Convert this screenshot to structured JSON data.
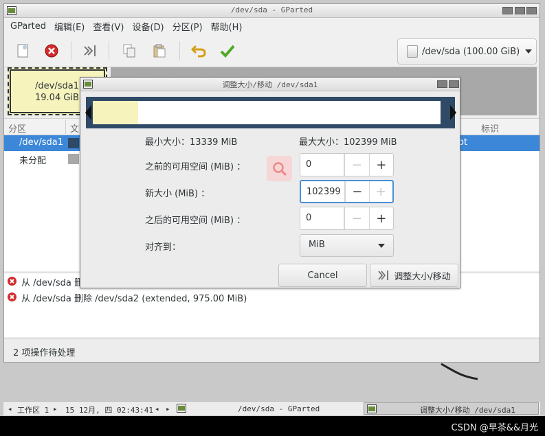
{
  "main_window": {
    "title": "/dev/sda - GParted",
    "menu": [
      "GParted",
      "编辑(E)",
      "查看(V)",
      "设备(D)",
      "分区(P)",
      "帮助(H)"
    ],
    "device_selector": "/dev/sda (100.00 GiB)"
  },
  "diskmap": {
    "partition_name": "/dev/sda1",
    "partition_size": "19.04 GiB"
  },
  "partition_list": {
    "headers": {
      "partition": "分区",
      "fs": "文",
      "flags": "标识"
    },
    "rows": [
      {
        "name": "/dev/sda1",
        "flag_partial": "ot",
        "selected": true,
        "fs_color": "#2f4a66"
      },
      {
        "name": "未分配",
        "flag_partial": "",
        "selected": false,
        "fs_color": "#a8a8a8"
      }
    ]
  },
  "operations": [
    "从 /dev/sda 删",
    "从 /dev/sda 删除 /dev/sda2 (extended, 975.00 MiB)"
  ],
  "status": "2 项操作待处理",
  "dialog": {
    "title": "调整大小/移动 /dev/sda1",
    "min_size": "最小大小：13339  MiB",
    "max_size": "最大大小：102399  MiB",
    "free_before_label": "之前的可用空间 (MiB) ：",
    "free_before_value": "0",
    "new_size_label": "新大小 (MiB) ：",
    "new_size_value": "102399",
    "free_after_label": "之后的可用空间 (MiB) ：",
    "free_after_value": "0",
    "align_label": "对齐到：",
    "align_value": "MiB",
    "cancel_label": "Cancel",
    "resize_label": "调整大小/移动",
    "used_fraction": 0.1302
  },
  "taskbar": {
    "workspace": "工作区 1",
    "datetime": "15 12月, 四 02:43:41",
    "task1": "/dev/sda - GParted",
    "task2": "调整大小/移动 /dev/sda1"
  },
  "watermark": "CSDN @早茶&&月光",
  "colors": {
    "accent": "#3d87d9",
    "partition_used": "#f6f3bd",
    "partition_outline": "#2f4a66",
    "unallocated": "#a8a8a8"
  }
}
